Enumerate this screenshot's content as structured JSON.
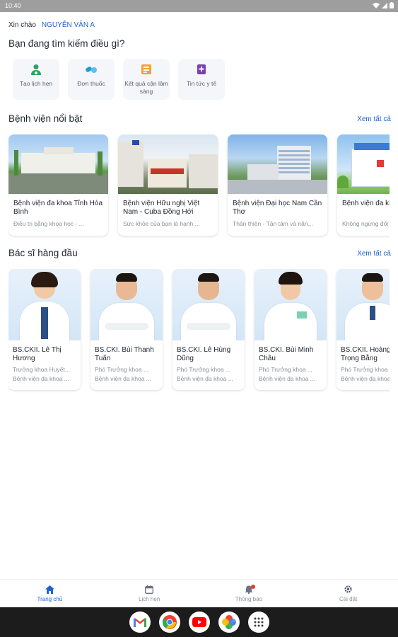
{
  "status_bar": {
    "time": "10:40"
  },
  "greeting": {
    "prefix": "Xin chào",
    "name": "NGUYỄN VĂN A"
  },
  "question": "Bạn đang tìm kiếm điều gì?",
  "services": [
    {
      "label": "Tạo lịch hẹn",
      "icon": "doctor-appointment-icon",
      "color": "#2aa55b"
    },
    {
      "label": "Đơn thuốc",
      "icon": "pill-icon",
      "color": "#1e9ad6"
    },
    {
      "label": "Kết quả cận lâm sàng",
      "icon": "lab-result-icon",
      "color": "#f2a03d"
    },
    {
      "label": "Tin tức y tế",
      "icon": "medical-news-icon",
      "color": "#7b3fb3"
    }
  ],
  "hospitals": {
    "title": "Bệnh viện nổi bật",
    "see_all": "Xem tất cả",
    "items": [
      {
        "name": "Bệnh viện đa khoa Tỉnh Hòa Bình",
        "desc": "Điều trị bằng khoa học - ..."
      },
      {
        "name": "Bệnh viện Hữu nghị Việt Nam - Cuba Đồng Hới",
        "desc": "Sức khỏe của bạn là hạnh ..."
      },
      {
        "name": "Bệnh viện Đại học Nam Cần Thơ",
        "desc": "Thân thiện - Tận tâm và năn..."
      },
      {
        "name": "Bệnh viện đa khoa Tân",
        "desc": "Không ngừng đổi mới..."
      }
    ]
  },
  "doctors": {
    "title": "Bác sĩ hàng đầu",
    "see_all": "Xem tất cả",
    "items": [
      {
        "name": "BS.CKII. Lê Thị Hương",
        "role": "Trưởng khoa Huyết...",
        "hospital": "Bệnh viện đa khoa ..."
      },
      {
        "name": "BS.CKI. Bùi Thanh Tuấn",
        "role": "Phó Trưởng khoa ...",
        "hospital": "Bệnh viện đa khoa ..."
      },
      {
        "name": "BS.CKI. Lê Hùng Dũng",
        "role": "Phó Trưởng khoa ...",
        "hospital": "Bệnh viện đa khoa ..."
      },
      {
        "name": "BS.CKI. Bùi Minh Châu",
        "role": "Phó Trưởng khoa ...",
        "hospital": "Bệnh viện đa khoa ..."
      },
      {
        "name": "BS.CKII. Hoàng Trọng Bằng",
        "role": "Phó Trưởng khoa ...",
        "hospital": "Bệnh viện đa khoa ..."
      }
    ]
  },
  "bottom_nav": [
    {
      "label": "Trang chủ",
      "icon": "home-icon",
      "active": true
    },
    {
      "label": "Lịch hẹn",
      "icon": "calendar-icon",
      "active": false
    },
    {
      "label": "Thông báo",
      "icon": "bell-icon",
      "active": false
    },
    {
      "label": "Cài đặt",
      "icon": "gear-icon",
      "active": false
    }
  ],
  "dock_apps": [
    "gmail-icon",
    "chrome-icon",
    "youtube-icon",
    "photos-icon",
    "app-drawer-icon"
  ],
  "colors": {
    "accent": "#1e63d6",
    "text": "#1f2430",
    "muted": "#8a909b"
  }
}
